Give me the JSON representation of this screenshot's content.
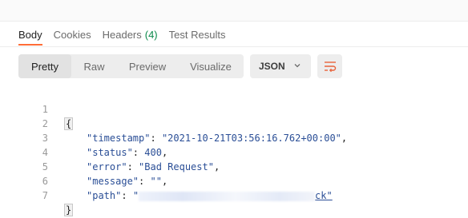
{
  "tabs": [
    {
      "label": "Body",
      "active": true
    },
    {
      "label": "Cookies",
      "active": false
    },
    {
      "label": "Headers",
      "count": "(4)",
      "active": false
    },
    {
      "label": "Test Results",
      "active": false
    }
  ],
  "view_modes": [
    {
      "label": "Pretty",
      "active": true
    },
    {
      "label": "Raw",
      "active": false
    },
    {
      "label": "Preview",
      "active": false
    },
    {
      "label": "Visualize",
      "active": false
    }
  ],
  "format_select": {
    "value": "JSON"
  },
  "icons": {
    "wrap": "wrap-lines-icon",
    "chevron": "chevron-down-icon"
  },
  "colors": {
    "accent": "#ff6c37",
    "count_green": "#0c8a4b",
    "json_value": "#2a4e96"
  },
  "response": {
    "line_numbers": [
      "1",
      "2",
      "3",
      "4",
      "5",
      "6",
      "7"
    ],
    "open_brace": "{",
    "close_brace": "}",
    "fields": [
      {
        "key": "\"timestamp\"",
        "value": "\"2021-10-21T03:56:16.762+00:00\"",
        "type": "string"
      },
      {
        "key": "\"status\"",
        "value": "400",
        "type": "number"
      },
      {
        "key": "\"error\"",
        "value": "\"Bad Request\"",
        "type": "string"
      },
      {
        "key": "\"message\"",
        "value": "\"\"",
        "type": "string"
      },
      {
        "key": "\"path\"",
        "value_head": "\"",
        "value_tail": "ck\"",
        "type": "redacted-link"
      }
    ]
  }
}
